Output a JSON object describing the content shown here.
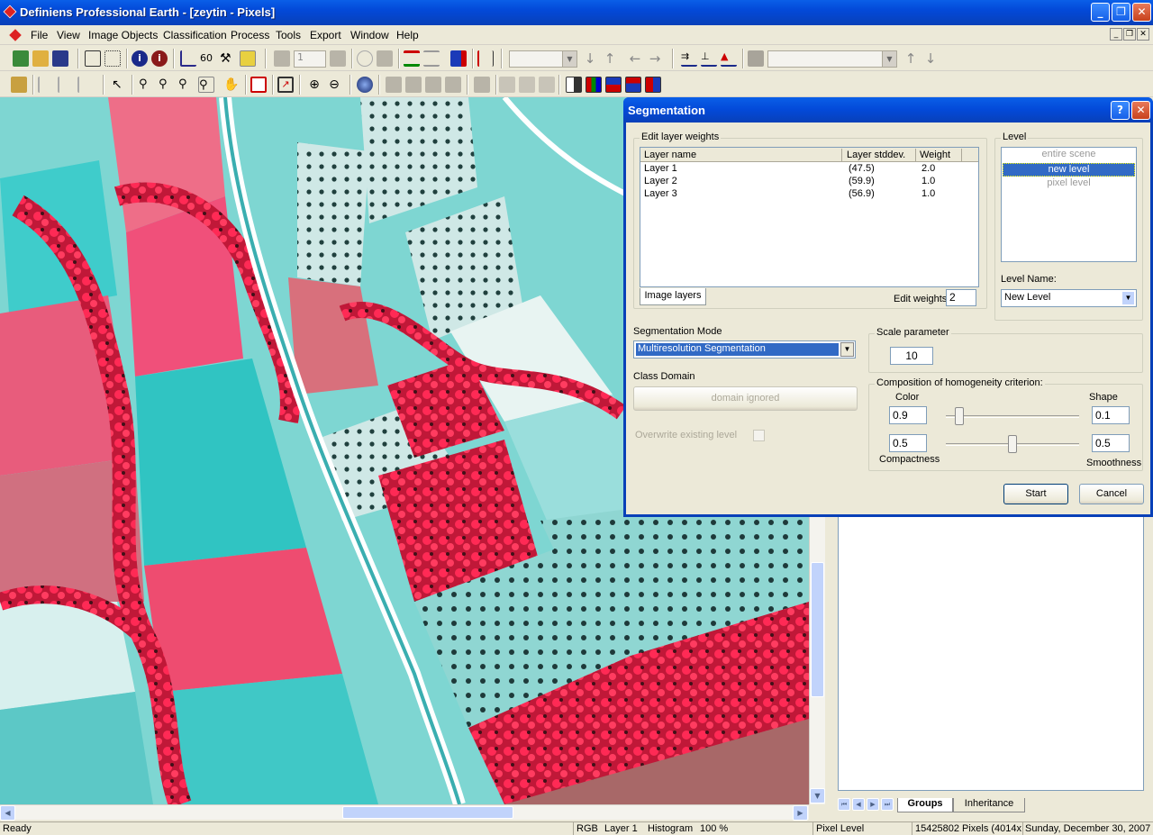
{
  "window": {
    "title": "Definiens Professional Earth - [zeytin - Pixels]",
    "minimize": "_",
    "restore": "❐",
    "close": "✕"
  },
  "menu": [
    "File",
    "View",
    "Image Objects",
    "Classification",
    "Process",
    "Tools",
    "Export",
    "Window",
    "Help"
  ],
  "toolbar": {
    "level_value": "1"
  },
  "dialog": {
    "title": "Segmentation",
    "help": "?",
    "close": "✕",
    "edit_layer_weights": {
      "legend": "Edit layer weights",
      "headers": [
        "Layer name",
        "Layer stddev.",
        "Weight"
      ],
      "rows": [
        {
          "name": "Layer 1",
          "stddev": "(47.5)",
          "weight": "2.0"
        },
        {
          "name": "Layer 2",
          "stddev": "(59.9)",
          "weight": "1.0"
        },
        {
          "name": "Layer 3",
          "stddev": "(56.9)",
          "weight": "1.0"
        }
      ],
      "tab": "Image layers",
      "edit_weights_label": "Edit weights:",
      "edit_weights_value": "2"
    },
    "level": {
      "legend": "Level",
      "items": [
        "entire scene",
        "new level",
        "pixel level"
      ],
      "selected": "new level",
      "name_label": "Level Name:",
      "name_value": "New Level"
    },
    "segmentation_mode": {
      "label": "Segmentation Mode",
      "value": "Multiresolution Segmentation"
    },
    "class_domain": {
      "label": "Class Domain",
      "button": "domain ignored"
    },
    "overwrite": {
      "label": "Overwrite existing level",
      "checked": false
    },
    "scale": {
      "legend": "Scale parameter",
      "value": "10"
    },
    "homogeneity": {
      "legend": "Composition of homogeneity criterion:",
      "color_label": "Color",
      "color_value": "0.9",
      "shape_label": "Shape",
      "shape_value": "0.1",
      "compactness_label": "Compactness",
      "compactness_value": "0.5",
      "smoothness_label": "Smoothness",
      "smoothness_value": "0.5",
      "shape_slider": 0.1,
      "compactness_slider": 0.5
    },
    "start": "Start",
    "cancel": "Cancel"
  },
  "panel_tabs": [
    "Groups",
    "Inheritance"
  ],
  "status": {
    "ready": "Ready",
    "mode": "RGB",
    "layer": "Layer 1",
    "stretch": "Histogram",
    "zoom": "100 %",
    "level": "Pixel Level",
    "pixels": "15425802 Pixels  (4014x",
    "date": "Sunday, December 30, 2007"
  },
  "colors": {
    "titlebar": "#0349d8",
    "selection": "#316ac5",
    "vegetation": "#ff1e4a",
    "field": "#4fd0cc"
  }
}
